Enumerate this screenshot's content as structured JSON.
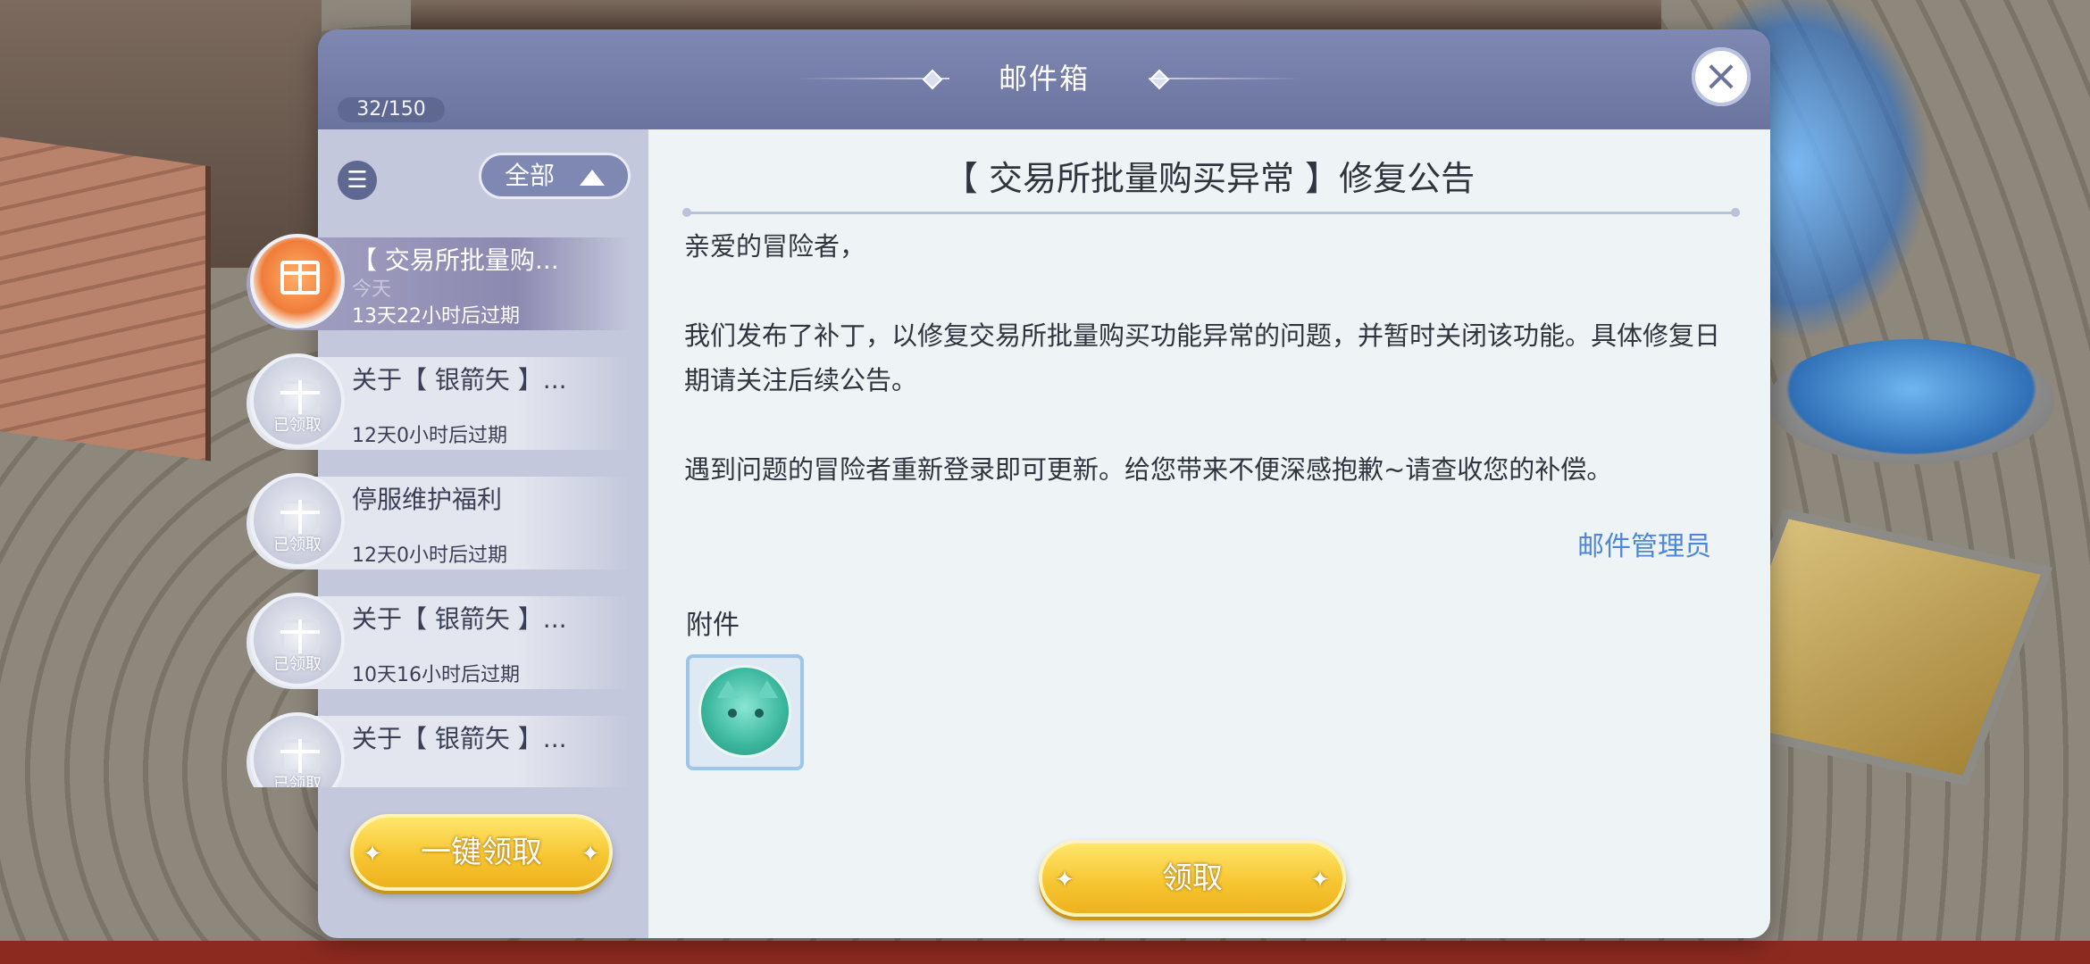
{
  "dialog": {
    "title": "邮件箱",
    "counter": "32/150",
    "close_label": "×"
  },
  "filter": {
    "list_icon": "list-icon",
    "selected": "全部"
  },
  "mails": [
    {
      "subject": "【 交易所批量购...",
      "date": "今天",
      "expire": "13天22小时后过期",
      "status": "",
      "icon": "gift-icon"
    },
    {
      "subject": "关于【 银箭矢 】...",
      "date": "",
      "expire": "12天0小时后过期",
      "status": "已领取",
      "icon": "gift-icon"
    },
    {
      "subject": "停服维护福利",
      "date": "",
      "expire": "12天0小时后过期",
      "status": "已领取",
      "icon": "gift-icon"
    },
    {
      "subject": "关于【 银箭矢 】...",
      "date": "",
      "expire": "10天16小时后过期",
      "status": "已领取",
      "icon": "gift-icon"
    },
    {
      "subject": "关于【 银箭矢 】...",
      "date": "",
      "expire": "",
      "status": "已领取",
      "icon": "gift-icon"
    }
  ],
  "claim_all_label": "一键领取",
  "detail": {
    "title": "【 交易所批量购买异常 】修复公告",
    "greeting": "亲爱的冒险者，",
    "paragraph1": "我们发布了补丁，以修复交易所批量购买功能异常的问题，并暂时关闭该功能。具体修复日期请关注后续公告。",
    "paragraph2": "遇到问题的冒险者重新登录即可更新。给您带来不便深感抱歉~请查收您的补偿。",
    "sender": "邮件管理员",
    "attachment_label": "附件",
    "attachment_icon": "slime-pet-icon",
    "claim_label": "领取"
  },
  "colors": {
    "header": "#7e88b2",
    "accent_link": "#4e86d8",
    "button_yellow": "#f7c633"
  }
}
